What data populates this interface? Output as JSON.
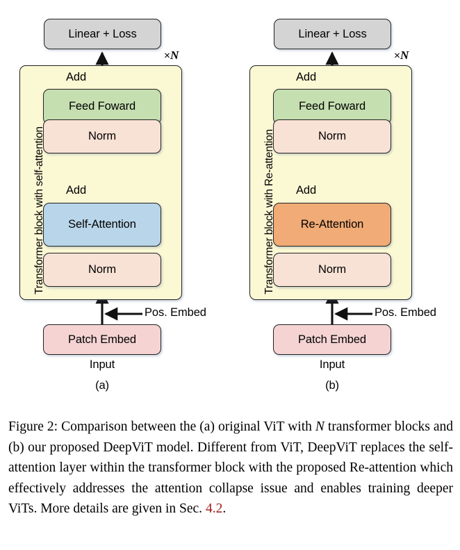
{
  "figure": {
    "panels": [
      {
        "key": "a",
        "sublabel": "(a)",
        "block_label": "Transformer block with self-attention",
        "repeat_label_prefix": "×",
        "repeat_label_symbol": "N",
        "nodes": {
          "linear": "Linear + Loss",
          "add_top": "Add",
          "feed_forward": "Feed Foward",
          "norm_top": "Norm",
          "add_bottom": "Add",
          "attention": "Self-Attention",
          "norm_bottom": "Norm",
          "patch_embed": "Patch Embed"
        },
        "pos_embed": "Pos. Embed",
        "input": "Input"
      },
      {
        "key": "b",
        "sublabel": "(b)",
        "block_label": "Transformer block with Re-attention",
        "repeat_label_prefix": "×",
        "repeat_label_symbol": "N",
        "nodes": {
          "linear": "Linear + Loss",
          "add_top": "Add",
          "feed_forward": "Feed Foward",
          "norm_top": "Norm",
          "add_bottom": "Add",
          "attention": "Re-Attention",
          "norm_bottom": "Norm",
          "patch_embed": "Patch Embed"
        },
        "pos_embed": "Pos. Embed",
        "input": "Input"
      }
    ],
    "colors": {
      "linear": "#d4d4d4",
      "feed_forward": "#c6dfb1",
      "norm": "#f8e2d5",
      "self_attention": "#b9d5e9",
      "re_attention": "#f0ab76",
      "patch_embed": "#f5d3d3",
      "transformer_block": "#fbf8d4",
      "stroke": "#222222",
      "section_reference": "#9e1b1b"
    }
  },
  "caption": {
    "label": "Figure 2:",
    "part1": " Comparison between the (a) original ViT with ",
    "italic1": "N",
    "part2": " transformer blocks and (b) our proposed DeepViT model. Different from ViT, DeepViT replaces the self-attention layer within the transformer block with the proposed Re-attention which effectively addresses the attention collapse issue and enables training deeper ViTs. More details are given in Sec. ",
    "section_ref": "4.2",
    "part3": "."
  }
}
